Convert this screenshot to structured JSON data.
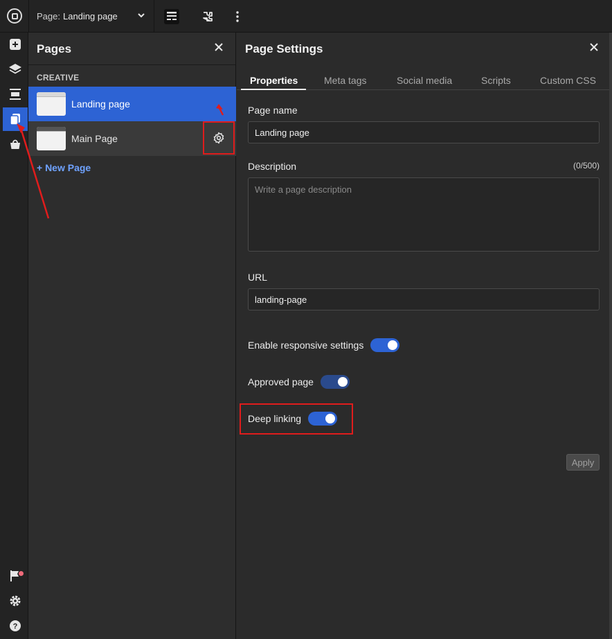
{
  "topbar": {
    "page_prefix": "Page:",
    "page_name": "Landing page"
  },
  "pages_panel": {
    "title": "Pages",
    "section": "CREATIVE",
    "items": [
      {
        "label": "Landing page",
        "selected": true
      },
      {
        "label": "Main Page",
        "selected": false
      }
    ],
    "new_page": "+ New Page"
  },
  "settings": {
    "title": "Page Settings",
    "tabs": [
      "Properties",
      "Meta tags",
      "Social media",
      "Scripts",
      "Custom CSS"
    ],
    "active_tab": "Properties",
    "page_name_label": "Page name",
    "page_name_value": "Landing page",
    "description_label": "Description",
    "description_counter": "(0/500)",
    "description_placeholder": "Write a page description",
    "url_label": "URL",
    "url_value": "landing-page",
    "toggles": [
      {
        "label": "Enable responsive settings",
        "on": true
      },
      {
        "label": "Approved page",
        "on": true
      },
      {
        "label": "Deep linking",
        "on": true
      }
    ],
    "apply_label": "Apply"
  },
  "colors": {
    "accent": "#2d63d4",
    "annotation": "#e01c1c",
    "link": "#6fa2ff"
  }
}
